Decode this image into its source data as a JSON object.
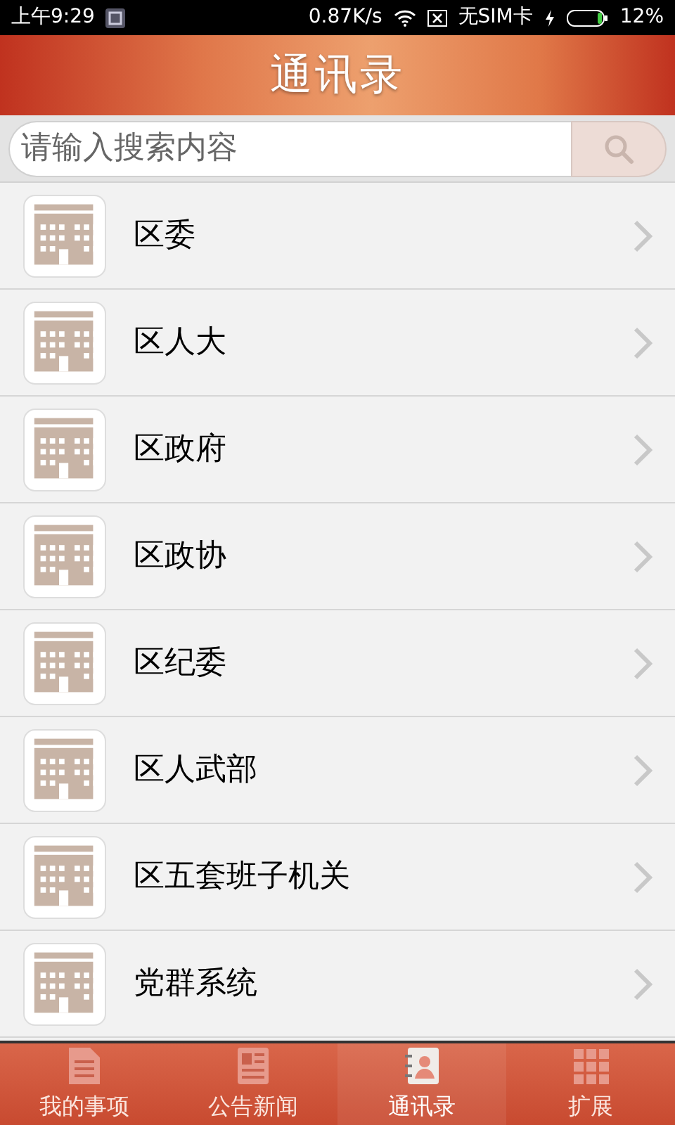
{
  "status_bar": {
    "time": "上午9:29",
    "speed": "0.87K/s",
    "sim": "无SIM卡",
    "battery": "12%"
  },
  "header": {
    "title": "通讯录"
  },
  "search": {
    "placeholder": "请输入搜索内容"
  },
  "contacts": [
    {
      "name": "区委"
    },
    {
      "name": "区人大"
    },
    {
      "name": "区政府"
    },
    {
      "name": "区政协"
    },
    {
      "name": "区纪委"
    },
    {
      "name": "区人武部"
    },
    {
      "name": "区五套班子机关"
    },
    {
      "name": "党群系统"
    }
  ],
  "tabs": [
    {
      "label": "我的事项",
      "kind": "document",
      "selected": false
    },
    {
      "label": "公告新闻",
      "kind": "news",
      "selected": false
    },
    {
      "label": "通讯录",
      "kind": "contacts",
      "selected": true
    },
    {
      "label": "扩展",
      "kind": "grid",
      "selected": false
    }
  ]
}
